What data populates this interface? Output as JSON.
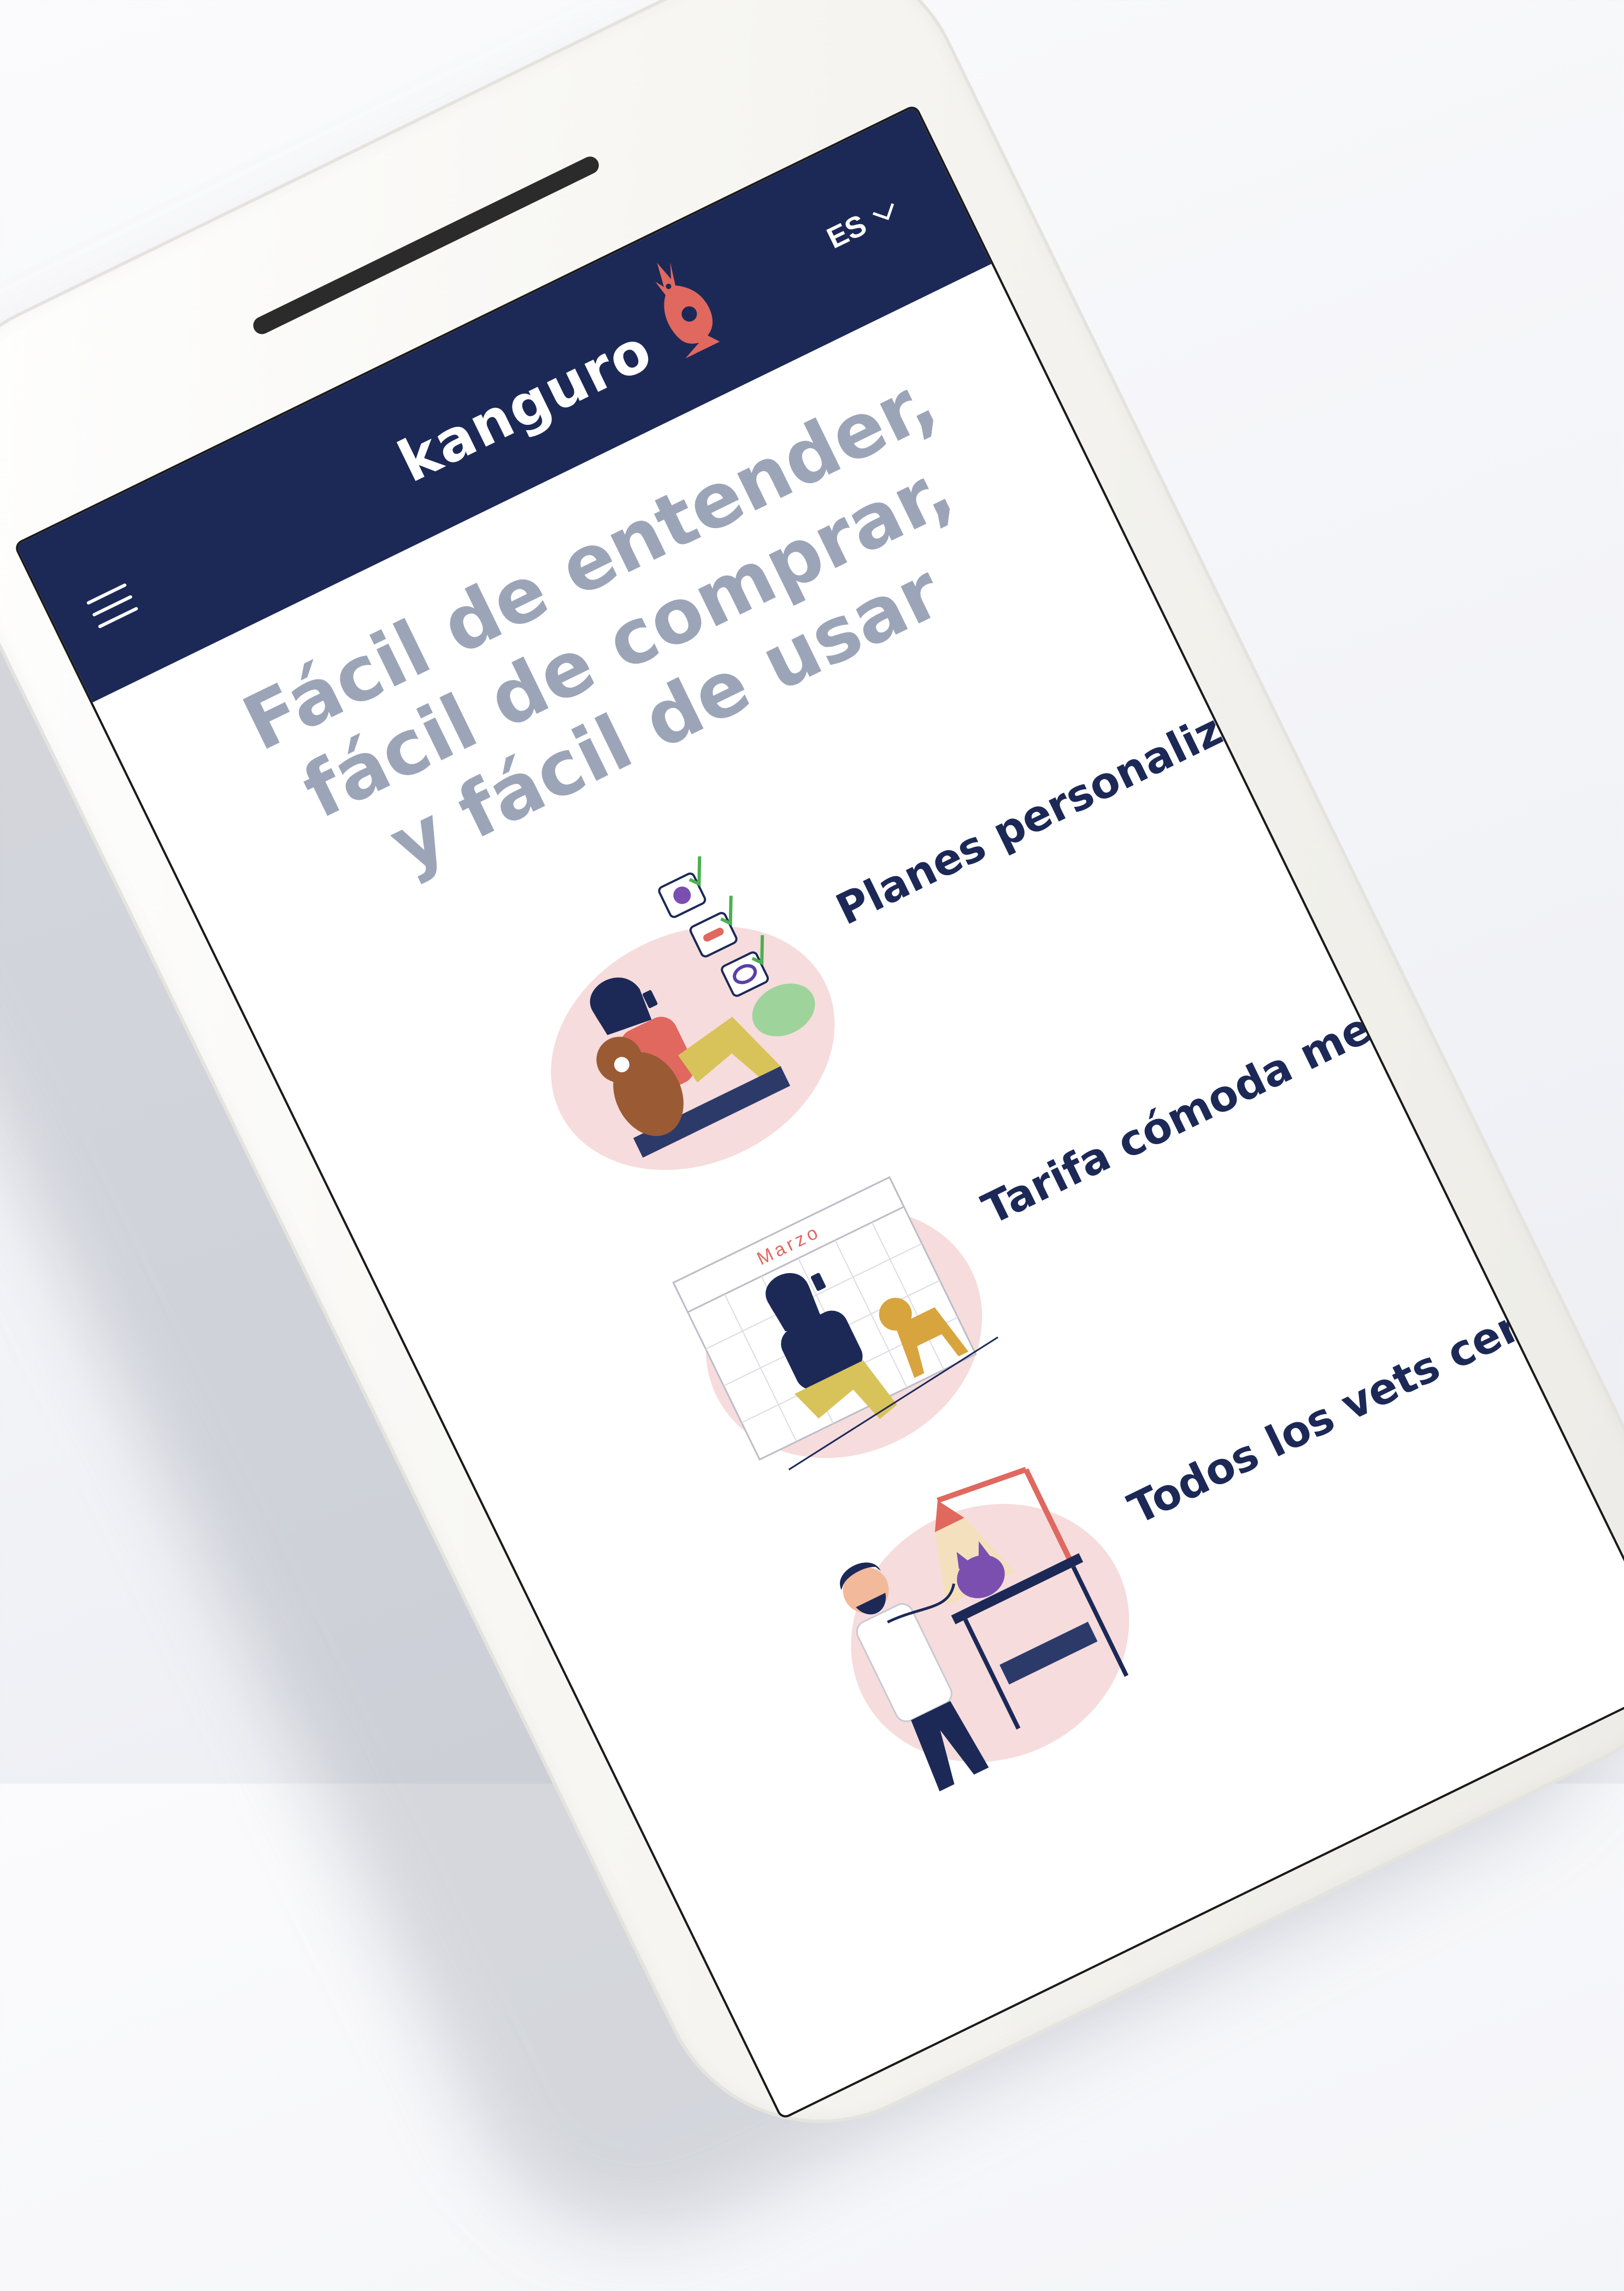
{
  "header": {
    "logo_text": "kanguro",
    "language": "ES"
  },
  "main": {
    "headline": "Fácil de entender, fácil de comprar, y fácil de usar",
    "features": [
      {
        "label": "Planes personalizados",
        "illustration": "woman-with-dog-checklist"
      },
      {
        "label": "Tarifa cómoda mensual",
        "illustration": "woman-dog-calendar",
        "calendar_month": "Marzo"
      },
      {
        "label": "Todos los vets certificados",
        "illustration": "vet-examining-cat"
      }
    ]
  },
  "colors": {
    "header_bg": "#1c2957",
    "headline": "#9ca5b8",
    "feature_text": "#1c2957",
    "logo_accent": "#e0685f",
    "blob": "#f6dcdc"
  }
}
